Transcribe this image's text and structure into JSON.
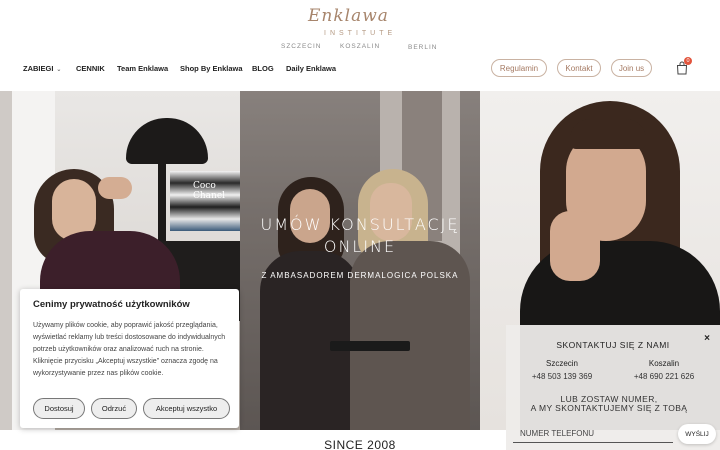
{
  "brand": {
    "logo_script": "Enklawa",
    "logo_sub": "INSTITUTE",
    "cities": [
      "SZCZECIN",
      "KOSZALIN",
      "BERLIN"
    ]
  },
  "nav": {
    "items": [
      {
        "label": "ZABIEGI",
        "has_dropdown": true
      },
      {
        "label": "CENNIK"
      },
      {
        "label": "Team Enklawa"
      },
      {
        "label": "Shop By Enklawa"
      },
      {
        "label": "BLOG"
      },
      {
        "label": "Daily Enklawa"
      }
    ],
    "pills": [
      "Regulamin",
      "Kontakt",
      "Join us"
    ],
    "cart_count": "0"
  },
  "hero": {
    "title_line1": "UMÓW KONSULTACJĘ",
    "title_line2": "ONLINE",
    "subtitle": "Z AMBASADOREM DERMALOGICA POLSKA",
    "book_label": "Coco Chanel"
  },
  "since": "SINCE 2008",
  "cookie": {
    "title": "Cenimy prywatność użytkowników",
    "text": "Używamy plików cookie, aby poprawić jakość przeglądania, wyświetlać reklamy lub treści dostosowane do indywidualnych potrzeb użytkowników oraz analizować ruch na stronie. Kliknięcie przycisku „Akceptuj wszystkie” oznacza zgodę na wykorzystywanie przez nas plików cookie.",
    "btn_customize": "Dostosuj",
    "btn_reject": "Odrzuć",
    "btn_accept": "Akceptuj wszystko"
  },
  "contact": {
    "title": "SKONTAKTUJ SIĘ Z NAMI",
    "close": "×",
    "locations": [
      {
        "city": "Szczecin",
        "phone": "+48 503 139 369"
      },
      {
        "city": "Koszalin",
        "phone": "+48 690 221 626"
      }
    ],
    "line1": "LUB ZOSTAW NUMER,",
    "line2": "A MY SKONTAKTUJEMY SIĘ Z TOBĄ",
    "input_placeholder": "NUMER TELEFONU",
    "send_label": "WYŚLIJ"
  },
  "colors": {
    "brand_accent": "#a7856c",
    "cart_badge": "#e2543c"
  }
}
